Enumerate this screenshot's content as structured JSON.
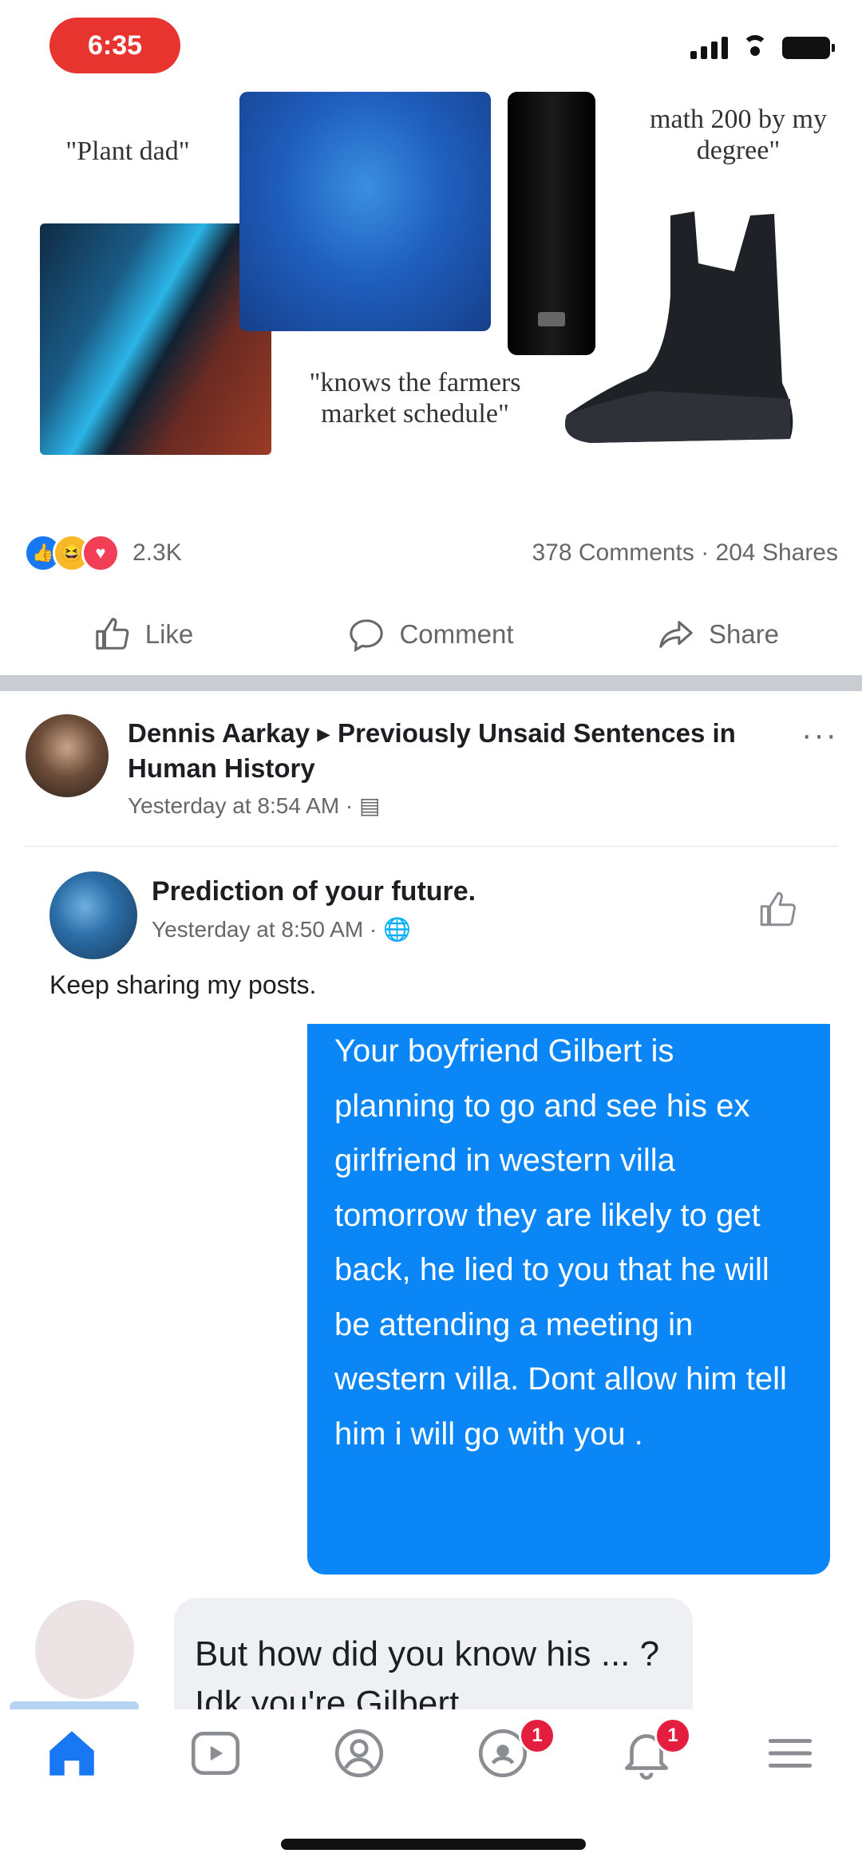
{
  "status_bar": {
    "time": "6:35"
  },
  "meme": {
    "caption_plant_dad": "\"Plant dad\"",
    "caption_math": "math 200 by my degree\"",
    "caption_market": "\"knows the farmers market schedule\""
  },
  "reactions": {
    "count": "2.3K",
    "comments_shares": "378 Comments · 204 Shares"
  },
  "actions": {
    "like": "Like",
    "comment": "Comment",
    "share": "Share"
  },
  "post": {
    "author": "Dennis Aarkay",
    "arrow": "▸",
    "group": "Previously Unsaid Sentences in Human History",
    "meta": "Yesterday at 8:54 AM ·"
  },
  "shared": {
    "name": "Prediction of your future.",
    "meta": "Yesterday at 8:50 AM ·",
    "text": "Keep sharing my posts."
  },
  "message": {
    "text": "Your boyfriend Gilbert is planning to go and see his ex girlfriend in western villa tomorrow they are likely to get back, he lied to you that he will be attending a meeting in western villa. Dont allow him tell him i will go with you ."
  },
  "reply": {
    "text": "But how did you know his  ... ? Idk you're Gilbert ..."
  },
  "tabbar": {
    "notif_badge": "1",
    "menu_badge": "1"
  },
  "colors": {
    "accent": "#1877f2",
    "bubble": "#0b86f7",
    "badge": "#e41e3f"
  }
}
